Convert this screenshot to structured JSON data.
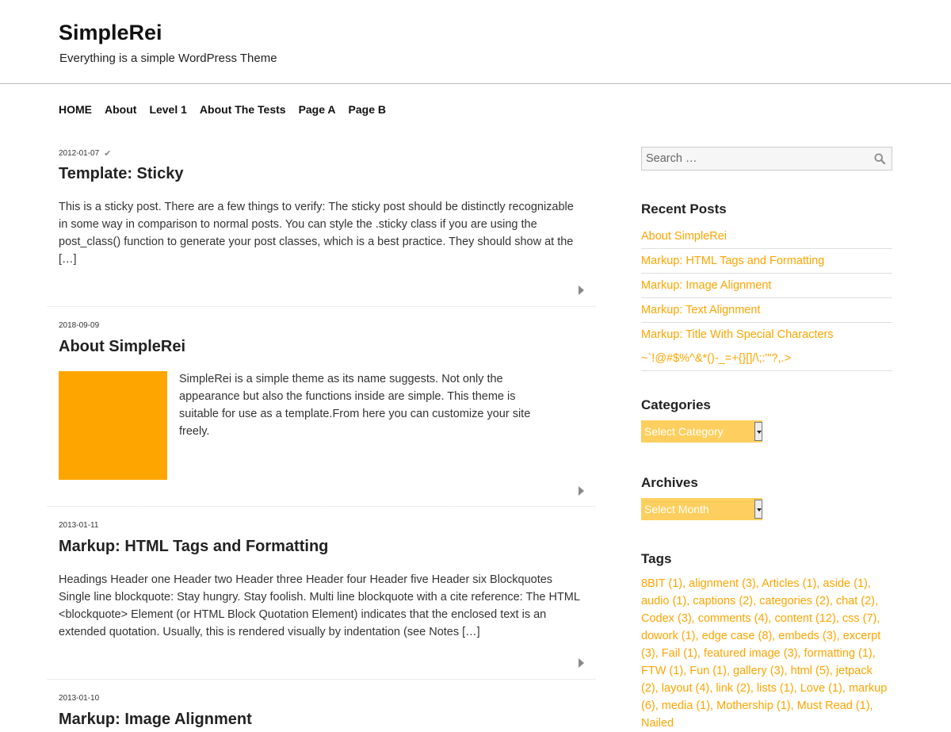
{
  "site": {
    "title": "SimpleRei",
    "description": "Everything is a simple WordPress Theme"
  },
  "nav": [
    "HOME",
    "About",
    "Level 1",
    "About The Tests",
    "Page A",
    "Page B"
  ],
  "posts": [
    {
      "date": "2012-01-07",
      "title": "Template: Sticky",
      "excerpt": "This is a sticky post. There are a few things to verify: The sticky post should be distinctly recognizable in some way in comparison to normal posts. You can style the .sticky class if you are using the post_class() function to generate your post classes, which is a best practice. They should show at the […]"
    },
    {
      "date": "2018-09-09",
      "title": "About SimpleRei",
      "excerpt": "SimpleRei is a simple theme as its name suggests. Not only the appearance but also the functions inside are simple. This theme is suitable for use as a template.From here you can customize your site freely."
    },
    {
      "date": "2013-01-11",
      "title": "Markup: HTML Tags and Formatting",
      "excerpt": "Headings Header one Header two Header three Header four Header five Header six Blockquotes Single line blockquote: Stay hungry. Stay foolish. Multi line blockquote with a cite reference: The HTML <blockquote> Element (or HTML Block Quotation Element) indicates that the enclosed text is an extended quotation. Usually, this is rendered visually by indentation (see Notes […]"
    },
    {
      "date": "2013-01-10",
      "title": "Markup: Image Alignment"
    }
  ],
  "sidebar": {
    "search_placeholder": "Search …",
    "recent_title": "Recent Posts",
    "recent": [
      "About SimpleRei",
      "Markup: HTML Tags and Formatting",
      "Markup: Image Alignment",
      "Markup: Text Alignment",
      "Markup: Title With Special Characters ~`!@#$%^&*()-_=+{}[]/\\;:'\"?,.>"
    ],
    "categories_title": "Categories",
    "categories_select": "Select Category",
    "archives_title": "Archives",
    "archives_select": "Select Month",
    "tags_title": "Tags",
    "tags": [
      "8BIT (1)",
      "alignment (3)",
      "Articles (1)",
      "aside (1)",
      "audio (1)",
      "captions (2)",
      "categories (2)",
      "chat (2)",
      "Codex (3)",
      "comments (4)",
      "content (12)",
      "css (7)",
      "dowork (1)",
      "edge case (8)",
      "embeds (3)",
      "excerpt (3)",
      "Fail (1)",
      "featured image (3)",
      "formatting (1)",
      "FTW (1)",
      "Fun (1)",
      "gallery (3)",
      "html (5)",
      "jetpack (2)",
      "layout (4)",
      "link (2)",
      "lists (1)",
      "Love (1)",
      "markup (6)",
      "media (1)",
      "Mothership (1)",
      "Must Read (1)",
      "Nailed"
    ]
  },
  "colors": {
    "accent": "#ffa500",
    "select_bg": "#fecf5e"
  }
}
